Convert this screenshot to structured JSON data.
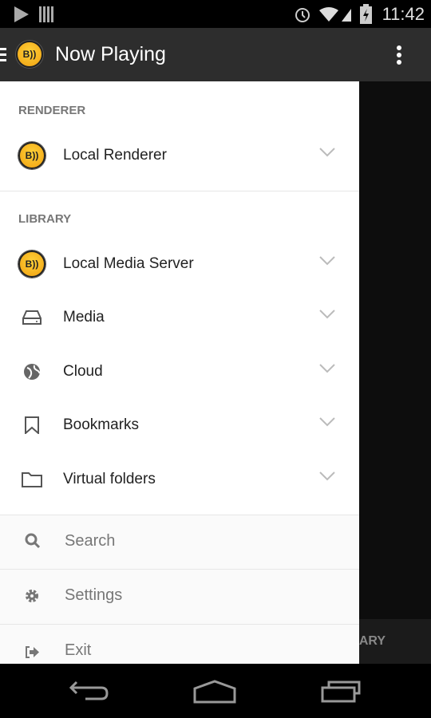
{
  "status_bar": {
    "time": "11:42",
    "icons": [
      "play-icon",
      "barcode-icon",
      "alarm-icon",
      "wifi-icon",
      "signal-icon",
      "battery-charging-icon"
    ]
  },
  "app_bar": {
    "title": "Now Playing",
    "logo_text": "B",
    "icons": [
      "hamburger-icon",
      "overflow-menu-icon"
    ]
  },
  "drawer": {
    "renderer_header": "RENDERER",
    "renderer_items": [
      {
        "label": "Local Renderer",
        "icon": "bubbleupnp-logo-icon"
      }
    ],
    "library_header": "LIBRARY",
    "library_items": [
      {
        "label": "Local Media Server",
        "icon": "bubbleupnp-logo-icon"
      },
      {
        "label": "Media",
        "icon": "drive-icon"
      },
      {
        "label": "Cloud",
        "icon": "globe-icon"
      },
      {
        "label": "Bookmarks",
        "icon": "bookmark-icon"
      },
      {
        "label": "Virtual folders",
        "icon": "folder-icon"
      }
    ],
    "bottom_items": [
      {
        "label": "Search",
        "icon": "search-icon"
      },
      {
        "label": "Settings",
        "icon": "gear-icon"
      },
      {
        "label": "Exit",
        "icon": "exit-icon"
      }
    ]
  },
  "main": {
    "tab_label": "LIBRARY"
  },
  "colors": {
    "app_bar": "#2d2d2d",
    "logo": "#f5b21a",
    "drawer": "#ffffff"
  }
}
